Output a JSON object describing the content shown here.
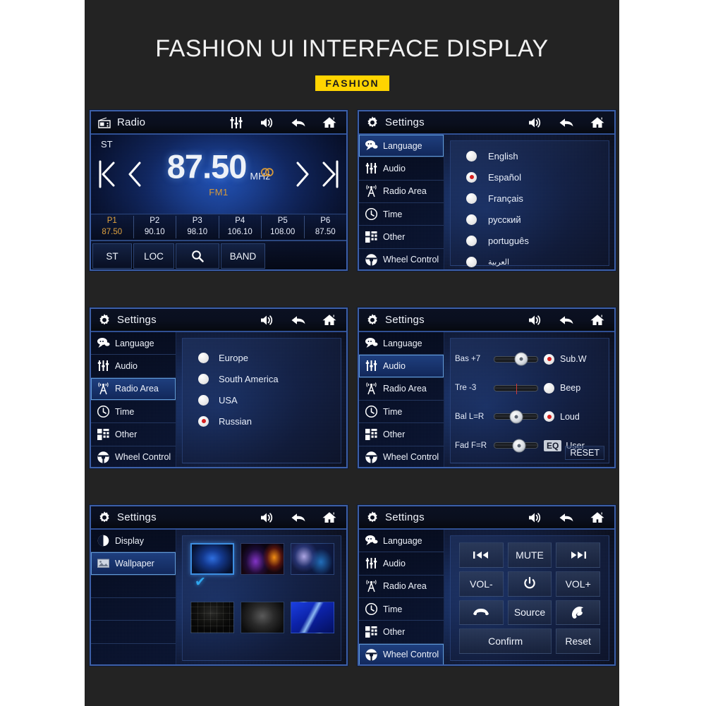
{
  "header": {
    "title": "FASHION UI INTERFACE DISPLAY",
    "badge": "FASHION",
    "badge_color": "#FFD400"
  },
  "common": {
    "settings_title": "Settings",
    "icons": {
      "equalizer": "equalizer-icon",
      "volume": "volume-icon",
      "back": "back-arrow-icon",
      "home": "home-icon",
      "gear": "gear-icon",
      "radio": "radio-icon"
    },
    "sidebar_items": [
      {
        "label": "Language",
        "icon": "speech-bubble-icon"
      },
      {
        "label": "Audio",
        "icon": "equalizer-icon"
      },
      {
        "label": "Radio Area",
        "icon": "antenna-icon"
      },
      {
        "label": "Time",
        "icon": "clock-icon"
      },
      {
        "label": "Other",
        "icon": "grid-blocks-icon"
      },
      {
        "label": "Wheel Control",
        "icon": "steering-wheel-icon"
      }
    ]
  },
  "screens": {
    "radio": {
      "title": "Radio",
      "stereo_indicator": "ST",
      "frequency": "87.50",
      "unit": "MHz",
      "band": "FM1",
      "band_color": "#d79a3a",
      "presets": [
        {
          "name": "P1",
          "freq": "87.50",
          "active": true
        },
        {
          "name": "P2",
          "freq": "90.10",
          "active": false
        },
        {
          "name": "P3",
          "freq": "98.10",
          "active": false
        },
        {
          "name": "P4",
          "freq": "106.10",
          "active": false
        },
        {
          "name": "P5",
          "freq": "108.00",
          "active": false
        },
        {
          "name": "P6",
          "freq": "87.50",
          "active": false
        }
      ],
      "buttons": [
        {
          "label": "ST"
        },
        {
          "label": "LOC"
        },
        {
          "label": "",
          "icon": "search-icon"
        },
        {
          "label": "BAND"
        }
      ]
    },
    "language": {
      "title": "Settings",
      "active_sidebar": "Language",
      "options": [
        {
          "label": "English",
          "selected": false
        },
        {
          "label": "Español",
          "selected": true
        },
        {
          "label": "Français",
          "selected": false
        },
        {
          "label": "русский",
          "selected": false
        },
        {
          "label": "português",
          "selected": false
        },
        {
          "label": "العربية",
          "selected": false
        }
      ]
    },
    "radio_area": {
      "title": "Settings",
      "active_sidebar": "Radio Area",
      "options": [
        {
          "label": "Europe",
          "selected": false
        },
        {
          "label": "South America",
          "selected": false
        },
        {
          "label": "USA",
          "selected": false
        },
        {
          "label": "Russian",
          "selected": true
        }
      ]
    },
    "audio": {
      "title": "Settings",
      "active_sidebar": "Audio",
      "sliders": [
        {
          "label": "Bas +7",
          "value_pct": 62
        },
        {
          "label": "Tre -3",
          "value_pct": 50,
          "hidden_knob": true
        },
        {
          "label": "Bal L=R",
          "value_pct": 50
        },
        {
          "label": "Fad F=R",
          "value_pct": 57
        }
      ],
      "toggles": [
        {
          "label": "Sub.W",
          "selected": true
        },
        {
          "label": "Beep",
          "selected": false
        },
        {
          "label": "Loud",
          "selected": true
        }
      ],
      "eq": {
        "chip": "EQ",
        "value": "User"
      },
      "reset_label": "RESET"
    },
    "display": {
      "title": "Settings",
      "sidebar_items": [
        {
          "label": "Display",
          "icon": "contrast-icon"
        },
        {
          "label": "Wallpaper",
          "icon": "picture-icon"
        }
      ],
      "active_sidebar": "Wallpaper",
      "wallpapers": [
        {
          "id": "wp1",
          "selected": true
        },
        {
          "id": "wp2",
          "selected": false
        },
        {
          "id": "wp3",
          "selected": false
        },
        {
          "id": "wp4",
          "selected": false
        },
        {
          "id": "wp5",
          "selected": false
        },
        {
          "id": "wp6",
          "selected": false
        }
      ],
      "check_mark": "✔"
    },
    "wheel_control": {
      "title": "Settings",
      "active_sidebar": "Wheel Control",
      "keys": [
        {
          "label": "",
          "icon": "prev-track-icon"
        },
        {
          "label": "MUTE",
          "icon": ""
        },
        {
          "label": "",
          "icon": "next-track-icon"
        },
        {
          "label": "VOL-",
          "icon": ""
        },
        {
          "label": "",
          "icon": "power-icon"
        },
        {
          "label": "VOL+",
          "icon": ""
        },
        {
          "label": "",
          "icon": "phone-hangup-icon"
        },
        {
          "label": "Source",
          "icon": ""
        },
        {
          "label": "",
          "icon": "phone-answer-icon"
        },
        {
          "label": "Confirm",
          "icon": ""
        },
        {
          "label": "Reset",
          "icon": ""
        }
      ]
    }
  }
}
